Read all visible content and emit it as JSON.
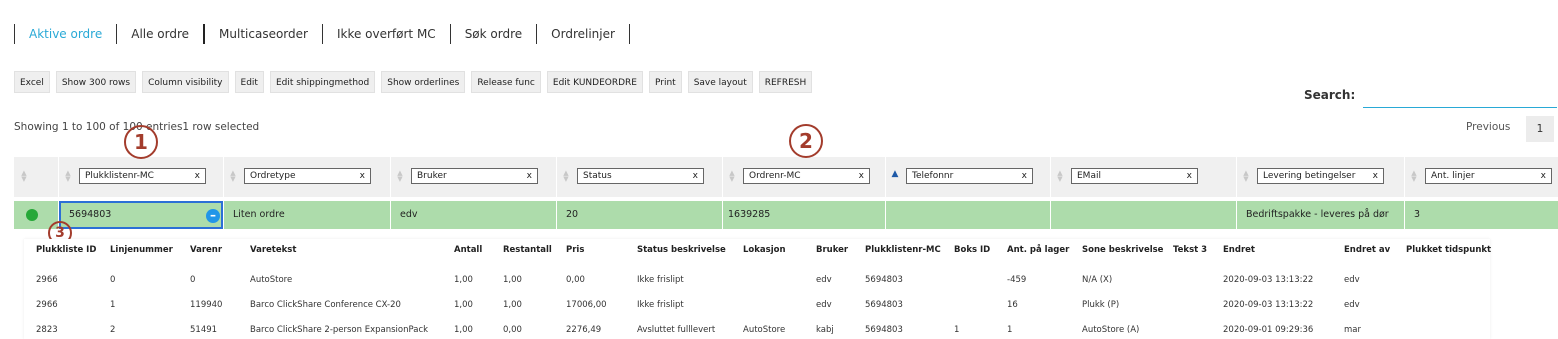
{
  "tabs": [
    "Aktive ordre",
    "Alle ordre",
    "Multicaseorder",
    "Ikke overført MC",
    "Søk ordre",
    "Ordrelinjer"
  ],
  "toolbar": [
    "Excel",
    "Show 300 rows",
    "Column visibility",
    "Edit",
    "Edit shippingmethod",
    "Show orderlines",
    "Release func",
    "Edit KUNDEORDRE",
    "Print",
    "Save layout",
    "REFRESH"
  ],
  "search": {
    "label": "Search:",
    "value": ""
  },
  "info_text": "Showing 1 to 100 of 100 entries1 row selected",
  "pagination": {
    "previous": "Previous",
    "page": "1"
  },
  "annotations": [
    "1",
    "2",
    "3"
  ],
  "filters": [
    "Plukklistenr-MC",
    "Ordretype",
    "Bruker",
    "Status",
    "Ordrenr-MC",
    "Telefonnr",
    "EMail",
    "Levering betingelser",
    "Ant. linjer"
  ],
  "filter_clear": "x",
  "selected_row": {
    "status_color": "#26a838",
    "plukkliste": "5694803",
    "ordretype": "Liten ordre",
    "bruker": "edv",
    "status": "20",
    "ordrenr": "1639285",
    "telefon": "",
    "email": "",
    "levering": "Bedriftspakke - leveres på dør",
    "ant_linjer": "3",
    "collapse_symbol": "–"
  },
  "detail": {
    "headers": [
      "Plukkliste ID",
      "Linjenummer",
      "Varenr",
      "Varetekst",
      "Antall",
      "Restantall",
      "Pris",
      "Status beskrivelse",
      "Lokasjon",
      "Bruker",
      "Plukklistenr-MC",
      "Boks ID",
      "Ant. på lager",
      "Sone beskrivelse",
      "Tekst 3",
      "Endret",
      "Endret av",
      "Plukket tidspunkt"
    ],
    "rows": [
      [
        "2966",
        "0",
        "0",
        "AutoStore",
        "1,00",
        "1,00",
        "0,00",
        "Ikke frislipt",
        "",
        "edv",
        "5694803",
        "",
        "-459",
        "N/A (X)",
        "",
        "2020-09-03 13:13:22",
        "edv",
        ""
      ],
      [
        "2966",
        "1",
        "119940",
        "Barco ClickShare Conference CX-20",
        "1,00",
        "1,00",
        "17006,00",
        "Ikke frislipt",
        "",
        "edv",
        "5694803",
        "",
        "16",
        "Plukk (P)",
        "",
        "2020-09-03 13:13:22",
        "edv",
        ""
      ],
      [
        "2823",
        "2",
        "51491",
        "Barco ClickShare 2-person ExpansionPack",
        "1,00",
        "0,00",
        "2276,49",
        "Avsluttet fulllevert",
        "AutoStore",
        "kabj",
        "5694803",
        "1",
        "1",
        "AutoStore (A)",
        "",
        "2020-09-01 09:29:36",
        "mar",
        ""
      ]
    ]
  }
}
